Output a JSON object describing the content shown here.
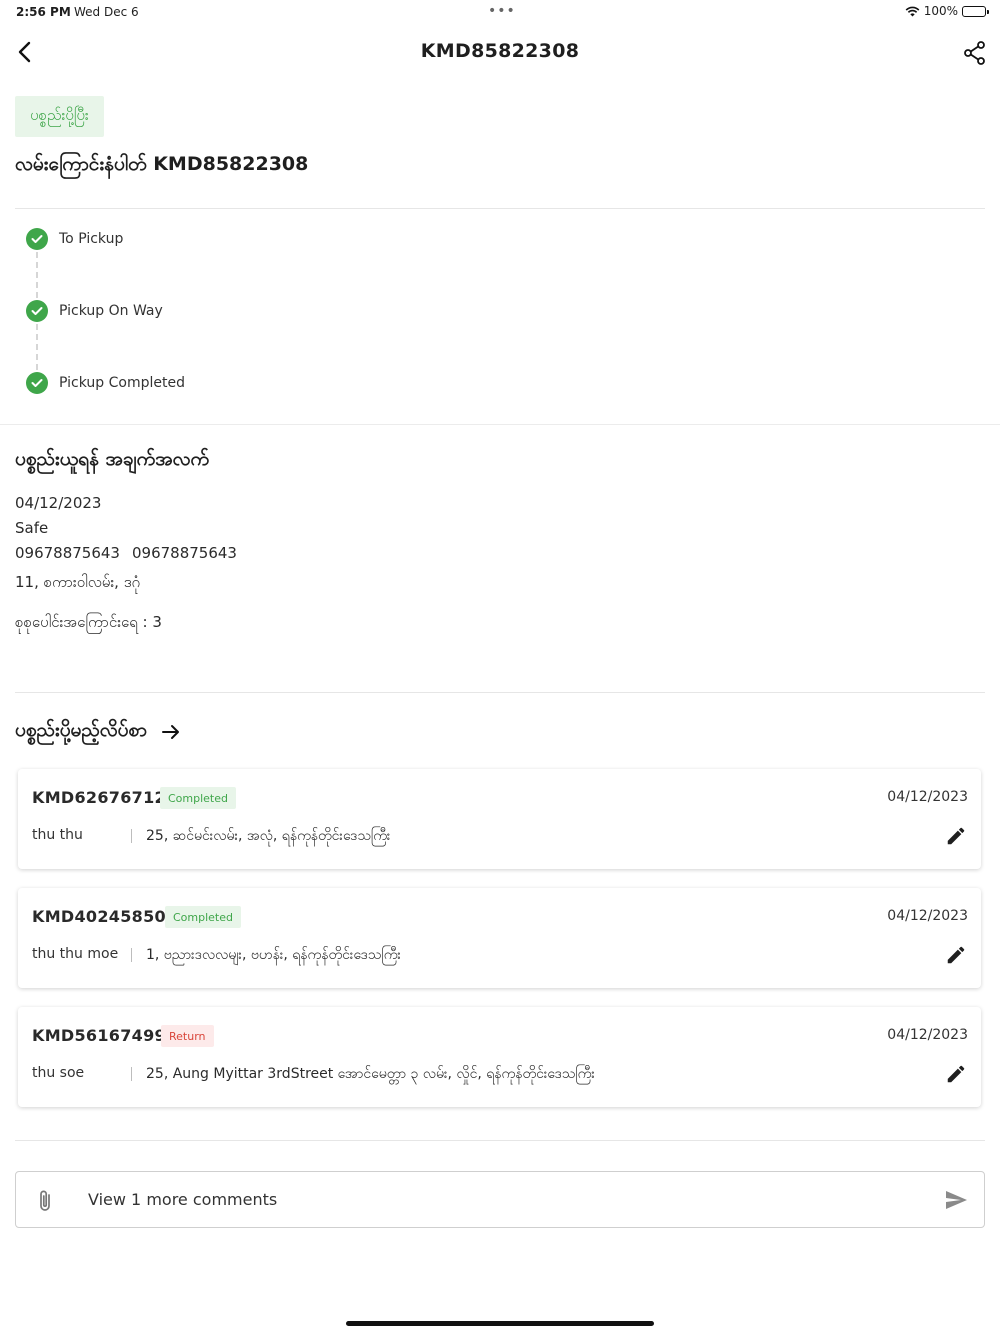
{
  "status_bar": {
    "time": "2:56 PM",
    "date": "Wed Dec 6",
    "battery": "100%"
  },
  "header": {
    "title": "KMD85822308"
  },
  "parcel": {
    "status_chip": "ပစ္စည်းပို့ပြီး",
    "title": "လမ်းကြောင်းနံပါတ် KMD85822308"
  },
  "timeline": [
    {
      "label": "To Pickup",
      "done": true
    },
    {
      "label": "Pickup On Way",
      "done": true
    },
    {
      "label": "Pickup Completed",
      "done": true
    }
  ],
  "pickup_info": {
    "title": "ပစ္စည်းယူရန် အချက်အလက်",
    "date": "04/12/2023",
    "name": "Safe",
    "phone_1": "09678875643",
    "phone_2": "09678875643",
    "address": "11, စကားဝါလမ်း, ဒဂုံ",
    "total_routes": "စုစုပေါင်းအကြောင်းရေ : 3"
  },
  "delivery_list": {
    "title": "ပစ္စည်းပို့မည့်လိပ်စာ",
    "items": [
      {
        "code": "KMD62676712",
        "status": "Completed",
        "status_type": "completed",
        "date": "04/12/2023",
        "recipient": "thu thu",
        "address": "25, ဆင်မင်းလမ်း, အလုံ, ရန်ကုန်တိုင်းဒေသကြီး"
      },
      {
        "code": "KMD40245850",
        "status": "Completed",
        "status_type": "completed",
        "date": "04/12/2023",
        "recipient": "thu thu moe",
        "address": "1, ဗညားဒလလမျး, ဗဟန်း, ရန်ကုန်တိုင်းဒေသကြီး"
      },
      {
        "code": "KMD56167499",
        "status": "Return",
        "status_type": "return",
        "date": "04/12/2023",
        "recipient": "thu soe",
        "address": "25, Aung Myittar 3rdStreet အောင်မေတ္တာ ၃ လမ်း, လှိုင်, ရန်ကုန်တိုင်းဒေသကြီး"
      }
    ]
  },
  "comments": {
    "view_more": "View 1 more comments"
  },
  "colors": {
    "success": "#3fa64a",
    "success_bg": "#e8f5e9",
    "return": "#d9453a",
    "return_bg": "#fdeaea"
  },
  "icons": {
    "back": "chevron-left-icon",
    "share": "share-icon",
    "check": "check-circle-icon",
    "arrow": "arrow-right-icon",
    "edit": "pencil-icon",
    "attach": "paperclip-icon",
    "send": "send-icon"
  }
}
